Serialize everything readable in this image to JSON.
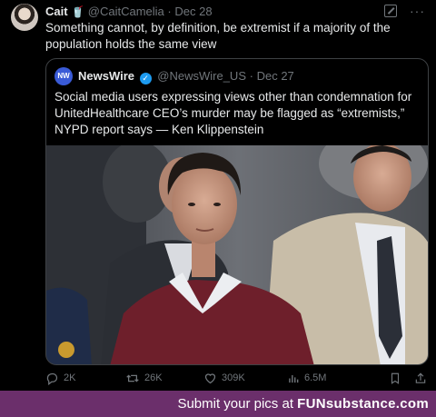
{
  "tweet": {
    "author_name": "Cait",
    "author_emoji": "🥤",
    "handle": "@CaitCamelia",
    "separator": "·",
    "date": "Dec 28",
    "text": "Something cannot, by definition, be extremist if a majority of the population holds the same view",
    "more_glyph": "···"
  },
  "quoted_tweet": {
    "avatar_label": "NW",
    "author_name": "NewsWire",
    "verified_glyph": "✓",
    "handle": "@NewsWire_US",
    "separator": "·",
    "date": "Dec 27",
    "text": "Social media users expressing views other than condemnation for UnitedHealthcare CEO’s murder may be flagged as “extremists,” NYPD report says — Ken Klippenstein"
  },
  "actions": {
    "replies": "2K",
    "retweets": "26K",
    "likes": "309K",
    "views": "6.5M"
  },
  "icons": {
    "reply": "speech-bubble-icon",
    "retweet": "retweet-arrows-icon",
    "like": "heart-icon",
    "views": "bar-chart-icon",
    "bookmark": "bookmark-icon",
    "share": "share-icon"
  },
  "watermark": {
    "prefix": "Submit your pics at ",
    "brand": "FUNsubstance.com"
  },
  "colors": {
    "background": "#000000",
    "text": "#e7e9ea",
    "muted": "#71767b",
    "verified": "#1d9bf0",
    "watermark_bg": "#6b2f6b"
  }
}
